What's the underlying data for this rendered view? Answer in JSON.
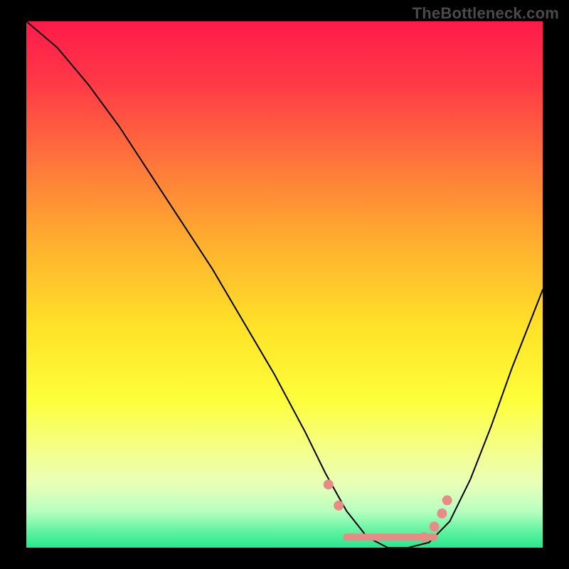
{
  "watermark": "TheBottleneck.com",
  "chart_data": {
    "type": "line",
    "title": "",
    "xlabel": "",
    "ylabel": "",
    "xlim": [
      0,
      100
    ],
    "ylim": [
      0,
      100
    ],
    "background_gradient": {
      "stops": [
        {
          "offset": 0.0,
          "color": "#ff1a4b"
        },
        {
          "offset": 0.12,
          "color": "#ff3a46"
        },
        {
          "offset": 0.28,
          "color": "#ff7a3a"
        },
        {
          "offset": 0.42,
          "color": "#ffaf2e"
        },
        {
          "offset": 0.58,
          "color": "#ffe228"
        },
        {
          "offset": 0.72,
          "color": "#fdff3a"
        },
        {
          "offset": 0.82,
          "color": "#f3ff8e"
        },
        {
          "offset": 0.88,
          "color": "#e8ffb8"
        },
        {
          "offset": 0.93,
          "color": "#b8ffc0"
        },
        {
          "offset": 0.97,
          "color": "#5ef3a0"
        },
        {
          "offset": 1.0,
          "color": "#28e690"
        }
      ]
    },
    "series": [
      {
        "name": "bottleneck-curve",
        "color": "#000000",
        "width": 2,
        "x": [
          0,
          6,
          12,
          18,
          24,
          30,
          36,
          42,
          48,
          54,
          58,
          62,
          66,
          70,
          74,
          78,
          82,
          86,
          90,
          94,
          98,
          100
        ],
        "y": [
          100,
          95,
          88,
          80,
          71,
          62,
          53,
          43,
          33,
          22,
          14,
          7,
          2,
          0,
          0,
          1,
          5,
          13,
          23,
          34,
          44,
          49
        ]
      }
    ],
    "highlight": {
      "name": "optimal-range",
      "color": "#e88b86",
      "thick_width": 10,
      "dot_radius": 7,
      "segment_x": [
        62,
        79
      ],
      "segment_y": [
        2,
        2
      ],
      "dots": [
        {
          "x": 58.5,
          "y": 12
        },
        {
          "x": 60.5,
          "y": 8
        },
        {
          "x": 77.0,
          "y": 2
        },
        {
          "x": 79.0,
          "y": 4
        },
        {
          "x": 80.5,
          "y": 6.5
        },
        {
          "x": 81.5,
          "y": 9
        }
      ]
    }
  }
}
